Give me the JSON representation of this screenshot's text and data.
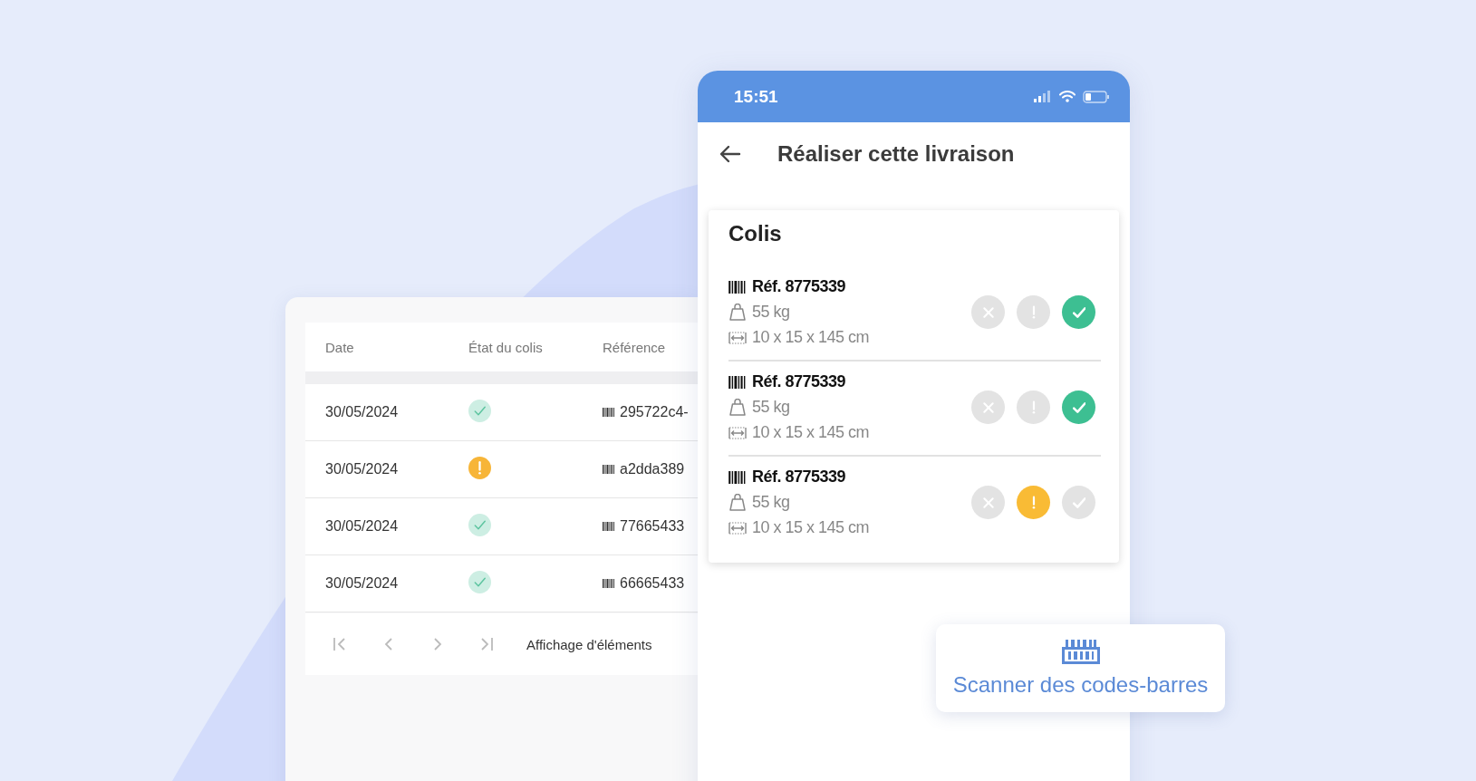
{
  "table": {
    "columns": [
      "Date",
      "État du colis",
      "Référence"
    ],
    "rows": [
      {
        "date": "30/05/2024",
        "warning": false,
        "reference": "295722c4-"
      },
      {
        "date": "30/05/2024",
        "warning": true,
        "reference": "a2dda389"
      },
      {
        "date": "30/05/2024",
        "warning": false,
        "reference": "77665433"
      },
      {
        "date": "30/05/2024",
        "warning": false,
        "reference": "66665433"
      }
    ],
    "pagination_info": "Affichage d'éléments"
  },
  "phone": {
    "status_bar": {
      "time": "15:51"
    },
    "title": "Réaliser cette livraison",
    "colis": {
      "title": "Colis",
      "items": [
        {
          "reference": "Réf. 8775339",
          "weight": "55 kg",
          "dimensions": "10 x 15 x 145 cm",
          "actions": [
            {
              "kind": "refuse",
              "selected": false
            },
            {
              "kind": "warning",
              "selected": false
            },
            {
              "kind": "confirm",
              "selected": true
            }
          ]
        },
        {
          "reference": "Réf. 8775339",
          "weight": "55 kg",
          "dimensions": "10 x 15 x 145 cm",
          "actions": [
            {
              "kind": "refuse",
              "selected": false
            },
            {
              "kind": "warning",
              "selected": false
            },
            {
              "kind": "confirm",
              "selected": true
            }
          ]
        },
        {
          "reference": "Réf. 8775339",
          "weight": "55 kg",
          "dimensions": "10 x 15 x 145 cm",
          "actions": [
            {
              "kind": "refuse",
              "selected": false
            },
            {
              "kind": "warning",
              "selected": true
            },
            {
              "kind": "confirm",
              "selected": false
            }
          ]
        }
      ]
    }
  },
  "scan_button": {
    "label": "Scanner des codes-barres"
  }
}
